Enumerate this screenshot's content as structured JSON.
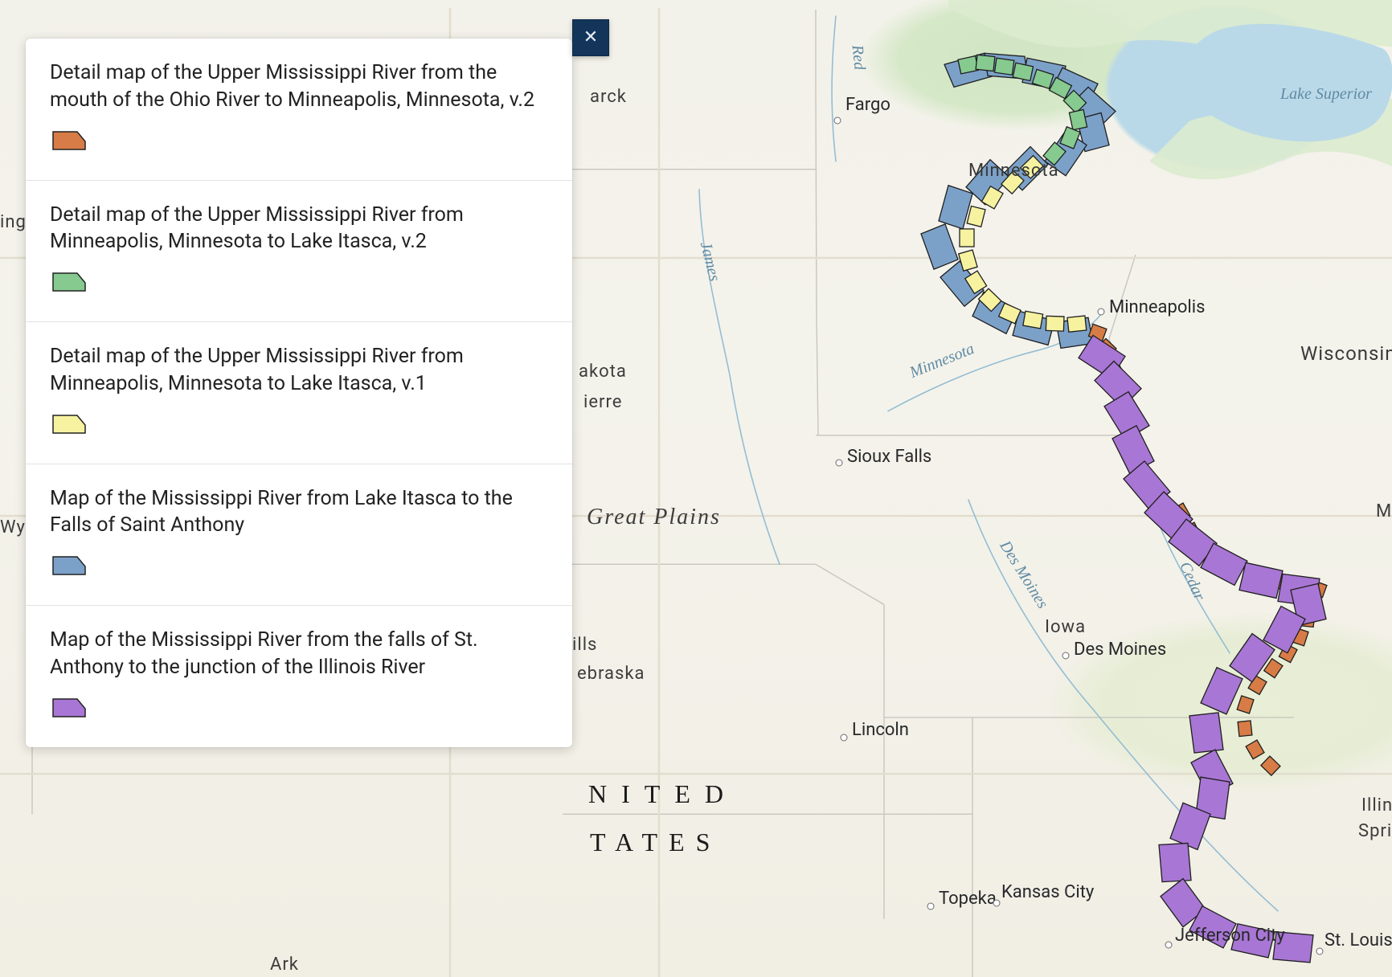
{
  "legend": {
    "items": [
      {
        "title": "Detail map of the Upper Mississippi River from the mouth of the Ohio River to Minneapolis, Minnesota, v.2",
        "color": "#d77c46"
      },
      {
        "title": "Detail map of the Upper Mississippi River from Minneapolis, Minnesota to Lake Itasca, v.2",
        "color": "#86ca90"
      },
      {
        "title": "Detail map of the Upper Mississippi River from Minneapolis, Minnesota to Lake Itasca, v.1",
        "color": "#f6f2a0"
      },
      {
        "title": "Map of the Mississippi River from Lake Itasca to the Falls of Saint Anthony",
        "color": "#7ca1c9"
      },
      {
        "title": "Map of the Mississippi River from the falls of St. Anthony to the junction of the Illinois River",
        "color": "#a876d4"
      }
    ]
  },
  "map": {
    "lake": "Lake Superior",
    "country_line1": "NITED",
    "country_line2": "TATES",
    "region": "Great Plains",
    "states": {
      "minnesota": "Minnesota",
      "wisconsin": "Wisconsin",
      "iowa": "Iowa"
    },
    "frags": {
      "wy": "Wy",
      "ing": "ing",
      "arck": "arck",
      "akota": "akota",
      "ierre": "ierre",
      "ills": "ills",
      "ebraska": "ebraska",
      "ma": "Ma",
      "illin": "Illin",
      "sprin": "Sprin",
      "ark": "Ark"
    },
    "rivers": {
      "james": "James",
      "minnesota": "Minnesota",
      "desmoines": "Des Moines",
      "cedar": "Cedar",
      "red": "Red"
    },
    "cities": {
      "fargo": "Fargo",
      "minneapolis": "Minneapolis",
      "sioux_falls": "Sioux Falls",
      "des_moines": "Des Moines",
      "lincoln": "Lincoln",
      "topeka": "Topeka",
      "kansas_city": "Kansas City",
      "jefferson_city": "Jefferson City",
      "st_louis": "St. Louis"
    }
  }
}
